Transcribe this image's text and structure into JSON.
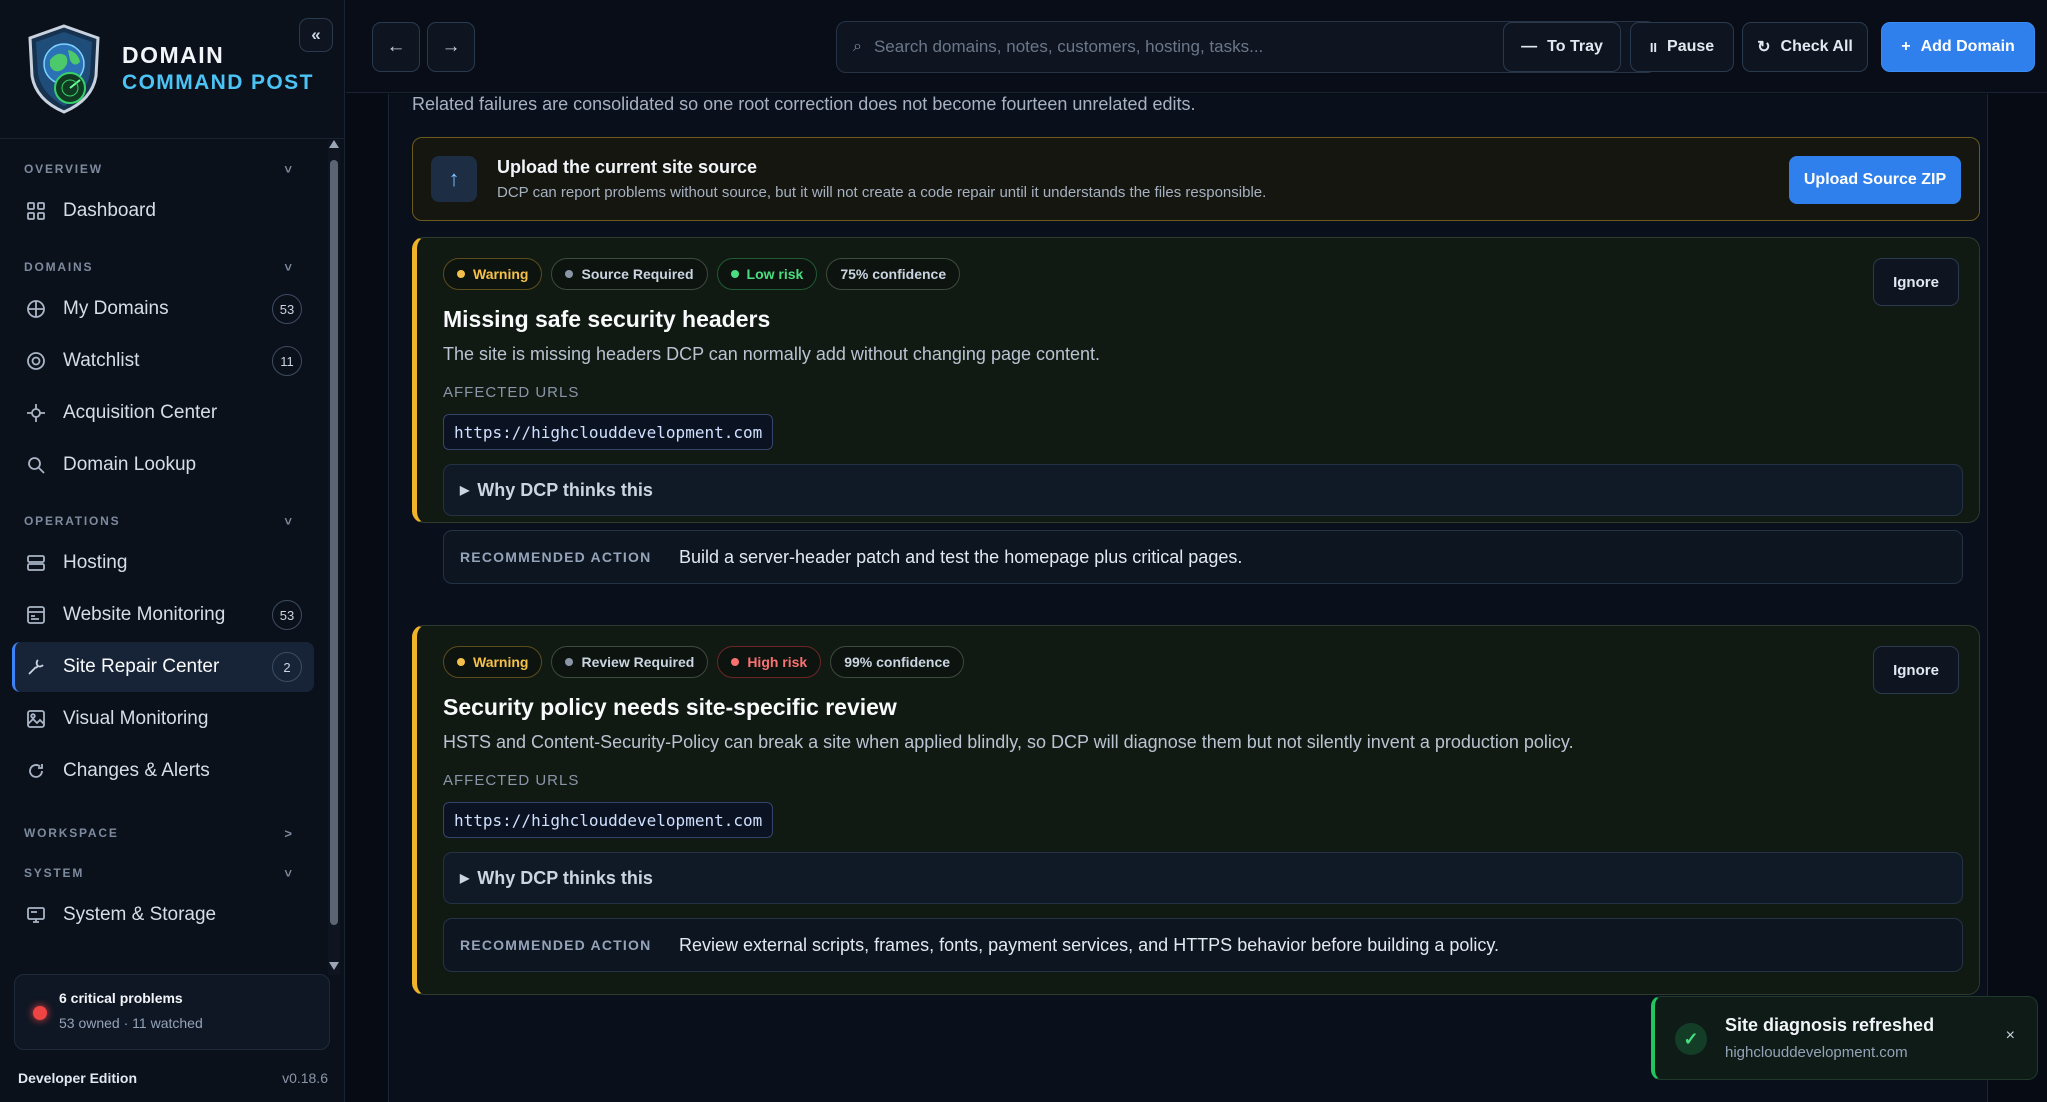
{
  "brand": {
    "line1": "DOMAIN",
    "line2": "COMMAND POST"
  },
  "sidebar": {
    "sections": [
      {
        "label": "OVERVIEW",
        "chevron": "˅"
      },
      {
        "label": "DOMAINS",
        "chevron": "˅"
      },
      {
        "label": "OPERATIONS",
        "chevron": "˅"
      },
      {
        "label": "WORKSPACE",
        "chevron": ">"
      },
      {
        "label": "SYSTEM",
        "chevron": "˅"
      }
    ],
    "items": [
      {
        "label": "Dashboard",
        "icon": "grid-icon"
      },
      {
        "label": "My Domains",
        "icon": "globe-icon",
        "count": "53"
      },
      {
        "label": "Watchlist",
        "icon": "eye-icon",
        "count": "11"
      },
      {
        "label": "Acquisition Center",
        "icon": "crosshair-icon"
      },
      {
        "label": "Domain Lookup",
        "icon": "search-icon"
      },
      {
        "label": "Hosting",
        "icon": "server-icon"
      },
      {
        "label": "Website Monitoring",
        "icon": "monitor-icon",
        "count": "53"
      },
      {
        "label": "Site Repair Center",
        "icon": "wrench-icon",
        "count": "2",
        "active": true
      },
      {
        "label": "Visual Monitoring",
        "icon": "image-icon"
      },
      {
        "label": "Changes & Alerts",
        "icon": "refresh-icon"
      },
      {
        "label": "System & Storage",
        "icon": "computer-icon"
      }
    ],
    "status": {
      "title": "6 critical problems",
      "subtitle": "53 owned · 11 watched",
      "color": "#ef4444"
    },
    "footer": {
      "edition": "Developer Edition",
      "version": "v0.18.6"
    }
  },
  "topbar": {
    "back": "←",
    "forward": "→",
    "search_placeholder": "Search domains, notes, customers, hosting, tasks...",
    "buttons": {
      "tray": "To Tray",
      "pause": "Pause",
      "check_all": "Check All",
      "add_domain": "Add Domain"
    },
    "collapse": "«"
  },
  "main": {
    "intro": "Related failures are consolidated so one root correction does not become fourteen unrelated edits.",
    "upload": {
      "title": "Upload the current site source",
      "subtitle": "DCP can report problems without source, but it will not create a code repair until it understands the files responsible.",
      "button": "Upload Source ZIP",
      "icon": "↑"
    },
    "issues": [
      {
        "pills": [
          {
            "label": "Warning",
            "kind": "warn"
          },
          {
            "label": "Source Required",
            "kind": "neutral"
          },
          {
            "label": "Low risk",
            "kind": "low"
          },
          {
            "label": "75% confidence",
            "kind": "plain"
          }
        ],
        "title": "Missing safe security headers",
        "description": "The site is missing headers DCP can normally add without changing page content.",
        "affected_label": "AFFECTED URLS",
        "url": "https://highclouddevelopment.com",
        "why": "Why DCP thinks this",
        "rec_label": "RECOMMENDED ACTION",
        "rec": "Build a server-header patch and test the homepage plus critical pages.",
        "ignore": "Ignore"
      },
      {
        "pills": [
          {
            "label": "Warning",
            "kind": "warn"
          },
          {
            "label": "Review Required",
            "kind": "neutral"
          },
          {
            "label": "High risk",
            "kind": "high"
          },
          {
            "label": "99% confidence",
            "kind": "plain"
          }
        ],
        "title": "Security policy needs site-specific review",
        "description": "HSTS and Content-Security-Policy can break a site when applied blindly, so DCP will diagnose them but not silently invent a production policy.",
        "affected_label": "AFFECTED URLS",
        "url": "https://highclouddevelopment.com",
        "why": "Why DCP thinks this",
        "rec_label": "RECOMMENDED ACTION",
        "rec": "Review external scripts, frames, fonts, payment services, and HTTPS behavior before building a policy.",
        "ignore": "Ignore"
      }
    ]
  },
  "toast": {
    "title": "Site diagnosis refreshed",
    "subtitle": "highclouddevelopment.com",
    "check": "✓",
    "close": "×"
  },
  "colors": {
    "accent": "#2f80ed",
    "warning": "#f0b429",
    "success": "#22c55e",
    "danger": "#ef4444"
  }
}
